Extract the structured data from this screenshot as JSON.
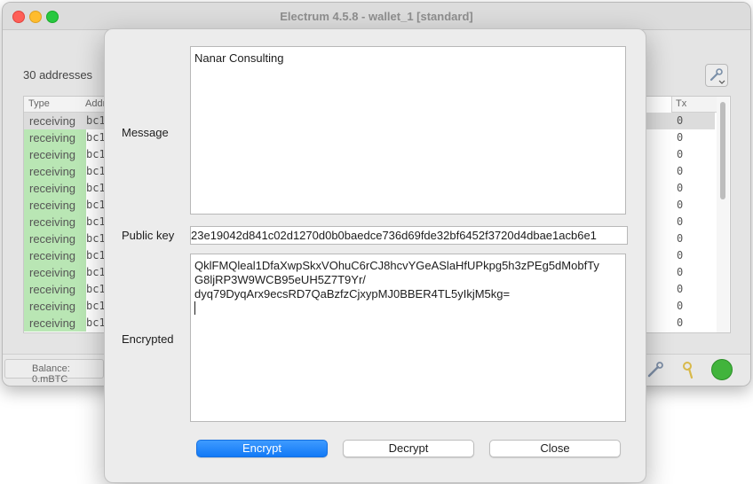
{
  "window": {
    "title": "Electrum 4.5.8  -  wallet_1  [standard]"
  },
  "addresses": {
    "count_label": "30 addresses",
    "headers": {
      "type": "Type",
      "address": "Addr",
      "tx": "Tx"
    },
    "rows": [
      {
        "type": "receiving",
        "address": "bc1",
        "tx": "0"
      },
      {
        "type": "receiving",
        "address": "bc1",
        "tx": "0"
      },
      {
        "type": "receiving",
        "address": "bc1",
        "tx": "0"
      },
      {
        "type": "receiving",
        "address": "bc1",
        "tx": "0"
      },
      {
        "type": "receiving",
        "address": "bc1",
        "tx": "0"
      },
      {
        "type": "receiving",
        "address": "bc1",
        "tx": "0"
      },
      {
        "type": "receiving",
        "address": "bc1",
        "tx": "0"
      },
      {
        "type": "receiving",
        "address": "bc1",
        "tx": "0"
      },
      {
        "type": "receiving",
        "address": "bc1",
        "tx": "0"
      },
      {
        "type": "receiving",
        "address": "bc1",
        "tx": "0"
      },
      {
        "type": "receiving",
        "address": "bc1",
        "tx": "0"
      },
      {
        "type": "receiving",
        "address": "bc1",
        "tx": "0"
      },
      {
        "type": "receiving",
        "address": "bc1",
        "tx": "0"
      }
    ]
  },
  "statusbar": {
    "balance": "Balance: 0.mBTC"
  },
  "dialog": {
    "message_label": "Message",
    "message_value": "Nanar Consulting",
    "pubkey_label": "Public key",
    "pubkey_value": "23e19042d841c02d1270d0b0baedce736d69fde32bf6452f3720d4dbae1acb6e1",
    "encrypted_label": "Encrypted",
    "encrypted_lines": [
      "QklFMQleal1DfaXwpSkxVOhuC6rCJ8hcvYGeASlaHfUPkpg5h3zPEg5dMobfTy",
      "G8ljRP3W9WCB95eUH5Z7T9Yr/",
      "dyq79DyqArx9ecsRD7QaBzfzCjxypMJ0BBER4TL5yIkjM5kg="
    ],
    "buttons": {
      "encrypt": "Encrypt",
      "decrypt": "Decrypt",
      "close": "Close"
    }
  },
  "colors": {
    "accent": "#1279f6",
    "receiving_bg": "#b9e6b4",
    "network_ok": "#41b43c"
  },
  "icons": {
    "tools": "tools-icon",
    "wrench": "preferences-icon",
    "seed": "seed-icon",
    "network": "network-status-icon"
  }
}
